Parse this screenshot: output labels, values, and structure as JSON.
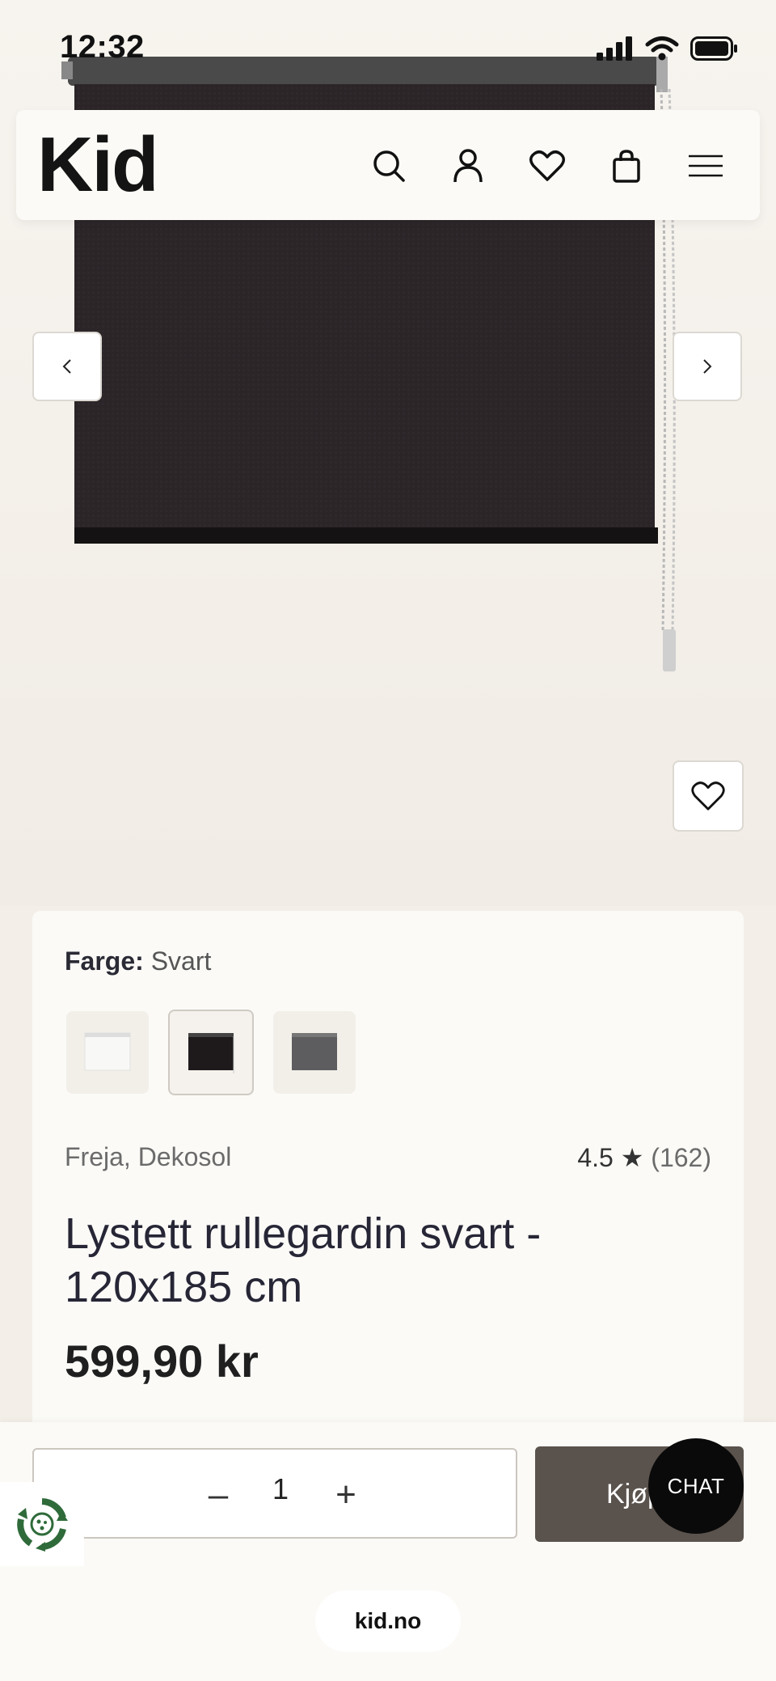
{
  "status_bar": {
    "time": "12:32",
    "icons": [
      "signal-icon",
      "wifi-icon",
      "battery-icon"
    ]
  },
  "header": {
    "logo": "Kid",
    "icons": [
      "search-icon",
      "account-icon",
      "wishlist-heart-icon",
      "shopping-bag-icon",
      "menu-icon"
    ]
  },
  "gallery": {
    "prev_icon": "chevron-left-icon",
    "next_icon": "chevron-right-icon",
    "favorite_icon": "heart-icon"
  },
  "product": {
    "color_label": "Farge:",
    "color_value": "Svart",
    "swatches": [
      {
        "name": "white",
        "color": "#f4f4f2",
        "selected": false
      },
      {
        "name": "black",
        "color": "#1e1a1c",
        "selected": true
      },
      {
        "name": "grey",
        "color": "#5d5d5f",
        "selected": false
      }
    ],
    "brand": "Freja, Dekosol",
    "rating": "4.5",
    "rating_star": "★",
    "review_count": "(162)",
    "title": "Lystett rullegardin svart - 120x185 cm",
    "price": "599,90 kr"
  },
  "purchase": {
    "qty_minus": "–",
    "qty_value": "1",
    "qty_plus": "+",
    "buy_label": "Kjøp",
    "chat_label": "CHAT"
  },
  "browser": {
    "url": "kid.no"
  },
  "colors": {
    "accent_dark": "#5a524c",
    "chat_bg": "#0a0a0a",
    "eco_green": "#2f6b3a"
  }
}
